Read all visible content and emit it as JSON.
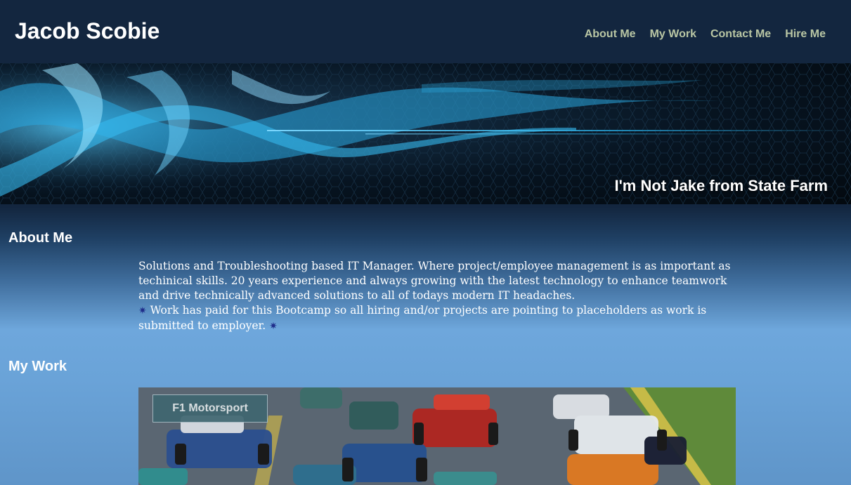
{
  "header": {
    "site_title": "Jacob Scobie",
    "nav": [
      "About Me",
      "My Work",
      "Contact Me",
      "Hire Me"
    ]
  },
  "hero": {
    "tagline": "I'm Not Jake from State Farm"
  },
  "about": {
    "heading": "About Me",
    "paragraph": "Solutions and Troubleshooting based IT Manager. Where project/employee management is as important as techinical skills. 20 years experience and always growing with the latest technology to enhance teamwork and drive technically advanced solutions to all of todays modern IT headaches.",
    "note_star": "✷",
    "note": "Work has paid for this Bootcamp so all hiring and/or projects are pointing to placeholders as work is submitted to employer."
  },
  "work": {
    "heading": "My Work",
    "projects": [
      {
        "label": "F1 Motorsport"
      }
    ]
  },
  "colors": {
    "header_bg": "#13263f",
    "nav_text": "#b9c6a4",
    "hero_accent": "#29b6f0",
    "gradient_light": "#6ea7dc",
    "card_label_bg": "#3f6670"
  }
}
